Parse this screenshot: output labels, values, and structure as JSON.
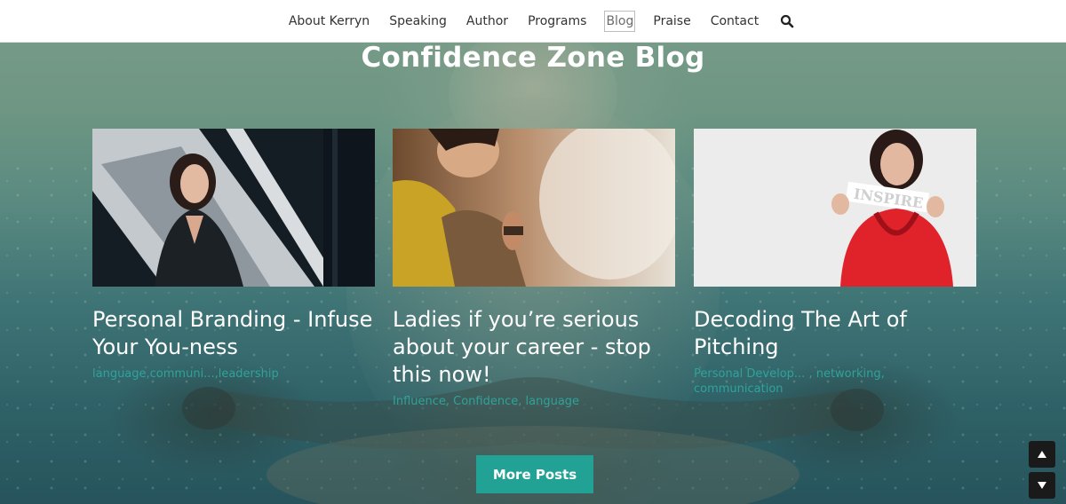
{
  "nav": {
    "items": [
      {
        "label": "About Kerryn",
        "active": false
      },
      {
        "label": "Speaking",
        "active": false
      },
      {
        "label": "Author",
        "active": false
      },
      {
        "label": "Programs",
        "active": false
      },
      {
        "label": "Blog",
        "active": true
      },
      {
        "label": "Praise",
        "active": false
      },
      {
        "label": "Contact",
        "active": false
      }
    ],
    "search_icon": "search-icon"
  },
  "section": {
    "title": "Confidence Zone Blog"
  },
  "posts": [
    {
      "title": "Personal Branding - Infuse Your You-ness",
      "tags": "language,communi...,leadership"
    },
    {
      "title": "Ladies if you’re serious about your career - stop this now!",
      "tags": "Influence, Confidence, language"
    },
    {
      "title": "Decoding The Art of Pitching",
      "tags": "Personal Develop... , networking, communication"
    }
  ],
  "more_button": {
    "label": "More Posts"
  },
  "colors": {
    "accent": "#22a195",
    "tag_text": "#2fa39a",
    "nav_bg": "#ffffff"
  },
  "scroll_controls": {
    "up_icon": "triangle-up-icon",
    "down_icon": "triangle-down-icon"
  }
}
